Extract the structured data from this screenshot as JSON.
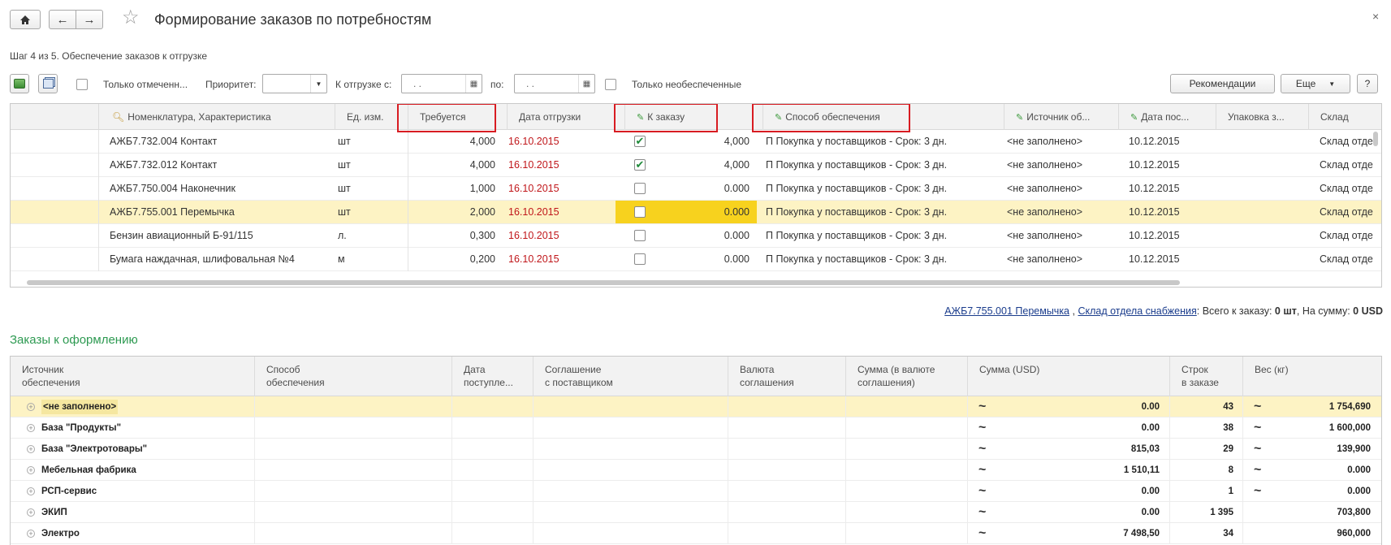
{
  "window": {
    "title": "Формирование заказов по потребностям",
    "close": "×"
  },
  "step": "Шаг 4 из 5. Обеспечение заказов к отгрузке",
  "toolbar": {
    "only_marked": "Только отмеченн...",
    "priority_label": "Приоритет:",
    "priority_value": "",
    "ship_from_label": "К отгрузке с:",
    "ship_from_value": ". .",
    "ship_to_label": "по:",
    "ship_to_value": ". .",
    "only_unprovided": "Только необеспеченные",
    "recommendations": "Рекомендации",
    "more": "Еще",
    "help": "?"
  },
  "grid1": {
    "columns": [
      "Номенклатура, Характеристика",
      "Ед. изм.",
      "Требуется",
      "Дата отгрузки",
      "К заказу",
      "Способ обеспечения",
      "Источник об...",
      "Дата пос...",
      "Упаковка з...",
      "Склад"
    ],
    "rows": [
      {
        "item": "АЖБ7.732.004 Контакт",
        "unit": "шт",
        "required": "4,000",
        "date": "16.10.2015",
        "checked": true,
        "order": "4,000",
        "method": "П Покупка у поставщиков - Срок: 3 дн.",
        "source": "<не заполнено>",
        "arrival": "10.12.2015",
        "pack": "",
        "warehouse": "Склад отде"
      },
      {
        "item": "АЖБ7.732.012 Контакт",
        "unit": "шт",
        "required": "4,000",
        "date": "16.10.2015",
        "checked": true,
        "order": "4,000",
        "method": "П Покупка у поставщиков - Срок: 3 дн.",
        "source": "<не заполнено>",
        "arrival": "10.12.2015",
        "pack": "",
        "warehouse": "Склад отде"
      },
      {
        "item": "АЖБ7.750.004 Наконечник",
        "unit": "шт",
        "required": "1,000",
        "date": "16.10.2015",
        "checked": false,
        "order": "0.000",
        "method": "П Покупка у поставщиков - Срок: 3 дн.",
        "source": "<не заполнено>",
        "arrival": "10.12.2015",
        "pack": "",
        "warehouse": "Склад отде"
      },
      {
        "item": "АЖБ7.755.001 Перемычка",
        "unit": "шт",
        "required": "2,000",
        "date": "16.10.2015",
        "checked": false,
        "order": "0.000",
        "method": "П Покупка у поставщиков - Срок: 3 дн.",
        "source": "<не заполнено>",
        "arrival": "10.12.2015",
        "pack": "",
        "warehouse": "Склад отде"
      },
      {
        "item": "Бензин авиационный Б-91/115",
        "unit": "л.",
        "required": "0,300",
        "date": "16.10.2015",
        "checked": false,
        "order": "0.000",
        "method": "П Покупка у поставщиков - Срок: 3 дн.",
        "source": "<не заполнено>",
        "arrival": "10.12.2015",
        "pack": "",
        "warehouse": "Склад отде"
      },
      {
        "item": "Бумага наждачная, шлифовальная №4",
        "unit": "м",
        "required": "0,200",
        "date": "16.10.2015",
        "checked": false,
        "order": "0.000",
        "method": "П Покупка у поставщиков - Срок: 3 дн.",
        "source": "<не заполнено>",
        "arrival": "10.12.2015",
        "pack": "",
        "warehouse": "Склад отде"
      }
    ],
    "selected_row": 3
  },
  "summary": {
    "item_link": "АЖБ7.755.001 Перемычка",
    "sep": ",",
    "warehouse_link": "Склад отдела снабжения",
    "text1": ": Всего к заказу: ",
    "qty": "0 шт",
    "text2": ", На сумму: ",
    "sum": "0 USD"
  },
  "section_title": "Заказы к оформлению",
  "grid2": {
    "columns": [
      "Источник\nобеспечения",
      "Способ\nобеспечения",
      "Дата\nпоступле...",
      "Соглашение\nс поставщиком",
      "Валюта\nсоглашения",
      "Сумма (в валюте\nсоглашения)",
      "Сумма (USD)",
      "Строк\nв заказе",
      "Вес (кг)"
    ],
    "rows": [
      {
        "source": "<не заполнено>",
        "sum_usd": "0.00",
        "lines": "43",
        "weight": "1 754,690"
      },
      {
        "source": "База \"Продукты\"",
        "sum_usd": "0.00",
        "lines": "38",
        "weight": "1 600,000"
      },
      {
        "source": "База \"Электротовары\"",
        "sum_usd": "815,03",
        "lines": "29",
        "weight": "139,900"
      },
      {
        "source": "Мебельная фабрика",
        "sum_usd": "1 510,11",
        "lines": "8",
        "weight": "0.000"
      },
      {
        "source": "РСП-сервис",
        "sum_usd": "0.00",
        "lines": "1",
        "weight": "0.000"
      },
      {
        "source": "ЭКИП",
        "sum_usd": "0.00",
        "lines": "1 395",
        "weight": "703,800"
      },
      {
        "source": "Электро",
        "sum_usd": "7 498,50",
        "lines": "34",
        "weight": "960,000"
      }
    ],
    "tilde": "~"
  },
  "colors": {
    "accent_green": "#2e9a52",
    "highlight": "#fdf3c4",
    "order_highlight": "#f7d21e",
    "date_red": "#c0161a",
    "redbox": "#d81c22"
  }
}
